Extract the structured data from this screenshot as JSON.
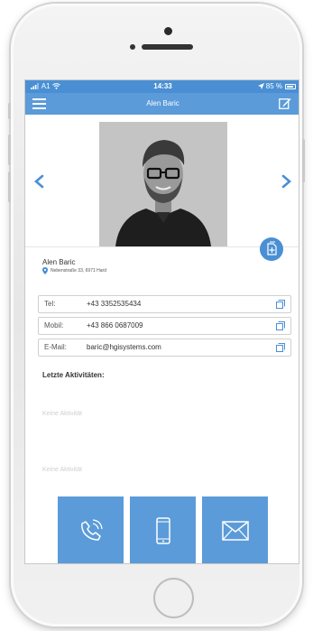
{
  "status_bar": {
    "carrier": "A1",
    "time": "14:33",
    "battery": "85 %"
  },
  "nav": {
    "title": "Alen Baric"
  },
  "contact": {
    "name": "Alen Baric",
    "address": "Nebenstraße 33, 6971 Hard"
  },
  "fields": [
    {
      "label": "Tel:",
      "value": "+43 3352535434"
    },
    {
      "label": "Mobil:",
      "value": "+43 866 0687009"
    },
    {
      "label": "E-Mail:",
      "value": "baric@hgisystems.com"
    }
  ],
  "activities": {
    "title": "Letzte Aktivitäten:",
    "empty_1": "Keine Aktivität",
    "empty_2": "Keine Aktivität"
  },
  "actions": {
    "call_icon": "phone-icon",
    "mobile_icon": "mobile-icon",
    "mail_icon": "mail-icon"
  },
  "colors": {
    "primary": "#5b9bd9",
    "status_bar": "#4a8fd4"
  }
}
